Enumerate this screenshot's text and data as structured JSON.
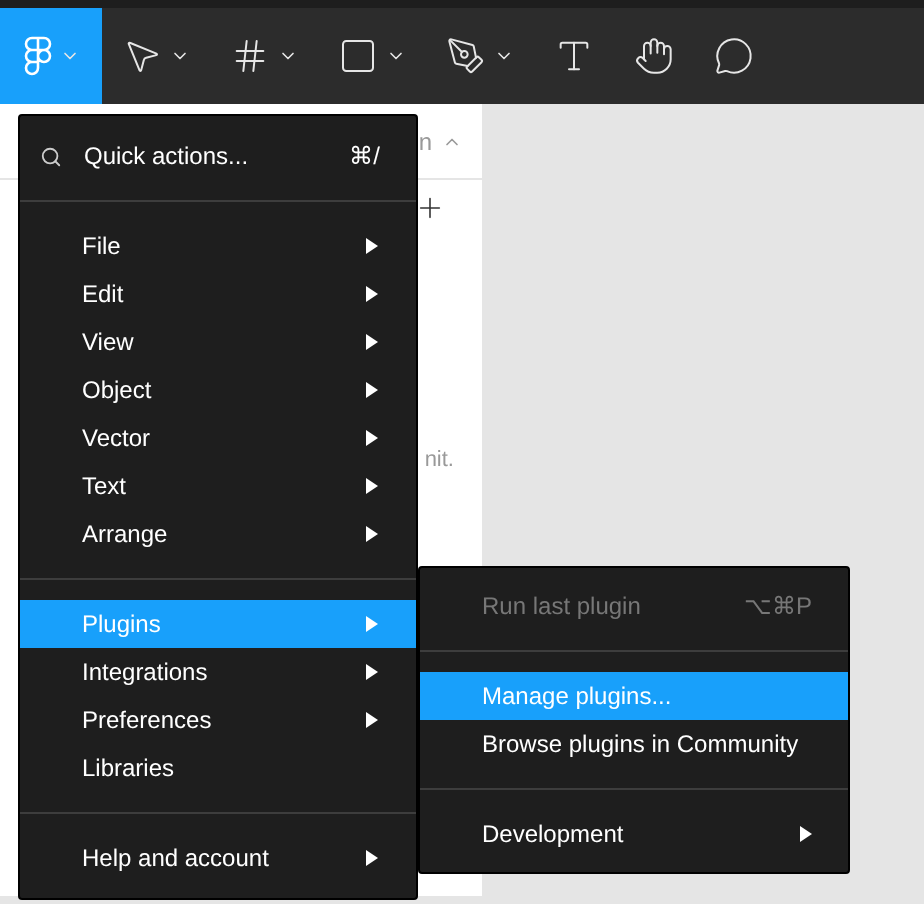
{
  "toolbar": {
    "tools": [
      {
        "kind": "main-menu",
        "selected": true,
        "dropdown": true
      },
      {
        "kind": "move",
        "selected": false,
        "dropdown": true
      },
      {
        "kind": "frame",
        "selected": false,
        "dropdown": true
      },
      {
        "kind": "shape",
        "selected": false,
        "dropdown": true
      },
      {
        "kind": "pen",
        "selected": false,
        "dropdown": true
      },
      {
        "kind": "text",
        "selected": false,
        "dropdown": false
      },
      {
        "kind": "hand",
        "selected": false,
        "dropdown": false
      },
      {
        "kind": "comment",
        "selected": false,
        "dropdown": false
      }
    ]
  },
  "left_panel": {
    "header_fragment": "n",
    "body_fragment": "nit."
  },
  "menu": {
    "quick_actions": {
      "label": "Quick actions...",
      "shortcut": "⌘/"
    },
    "groups": [
      [
        {
          "label": "File",
          "submenu": true,
          "selected": false
        },
        {
          "label": "Edit",
          "submenu": true,
          "selected": false
        },
        {
          "label": "View",
          "submenu": true,
          "selected": false
        },
        {
          "label": "Object",
          "submenu": true,
          "selected": false
        },
        {
          "label": "Vector",
          "submenu": true,
          "selected": false
        },
        {
          "label": "Text",
          "submenu": true,
          "selected": false
        },
        {
          "label": "Arrange",
          "submenu": true,
          "selected": false
        }
      ],
      [
        {
          "label": "Plugins",
          "submenu": true,
          "selected": true
        },
        {
          "label": "Integrations",
          "submenu": true,
          "selected": false
        },
        {
          "label": "Preferences",
          "submenu": true,
          "selected": false
        },
        {
          "label": "Libraries",
          "submenu": false,
          "selected": false
        }
      ],
      [
        {
          "label": "Help and account",
          "submenu": true,
          "selected": false
        }
      ]
    ]
  },
  "submenu": {
    "groups": [
      [
        {
          "label": "Run last plugin",
          "shortcut": "⌥⌘P",
          "disabled": true,
          "selected": false,
          "submenu": false
        }
      ],
      [
        {
          "label": "Manage plugins...",
          "disabled": false,
          "selected": true,
          "submenu": false
        },
        {
          "label": "Browse plugins in Community",
          "disabled": false,
          "selected": false,
          "submenu": false
        }
      ],
      [
        {
          "label": "Development",
          "disabled": false,
          "selected": false,
          "submenu": true
        }
      ]
    ]
  }
}
